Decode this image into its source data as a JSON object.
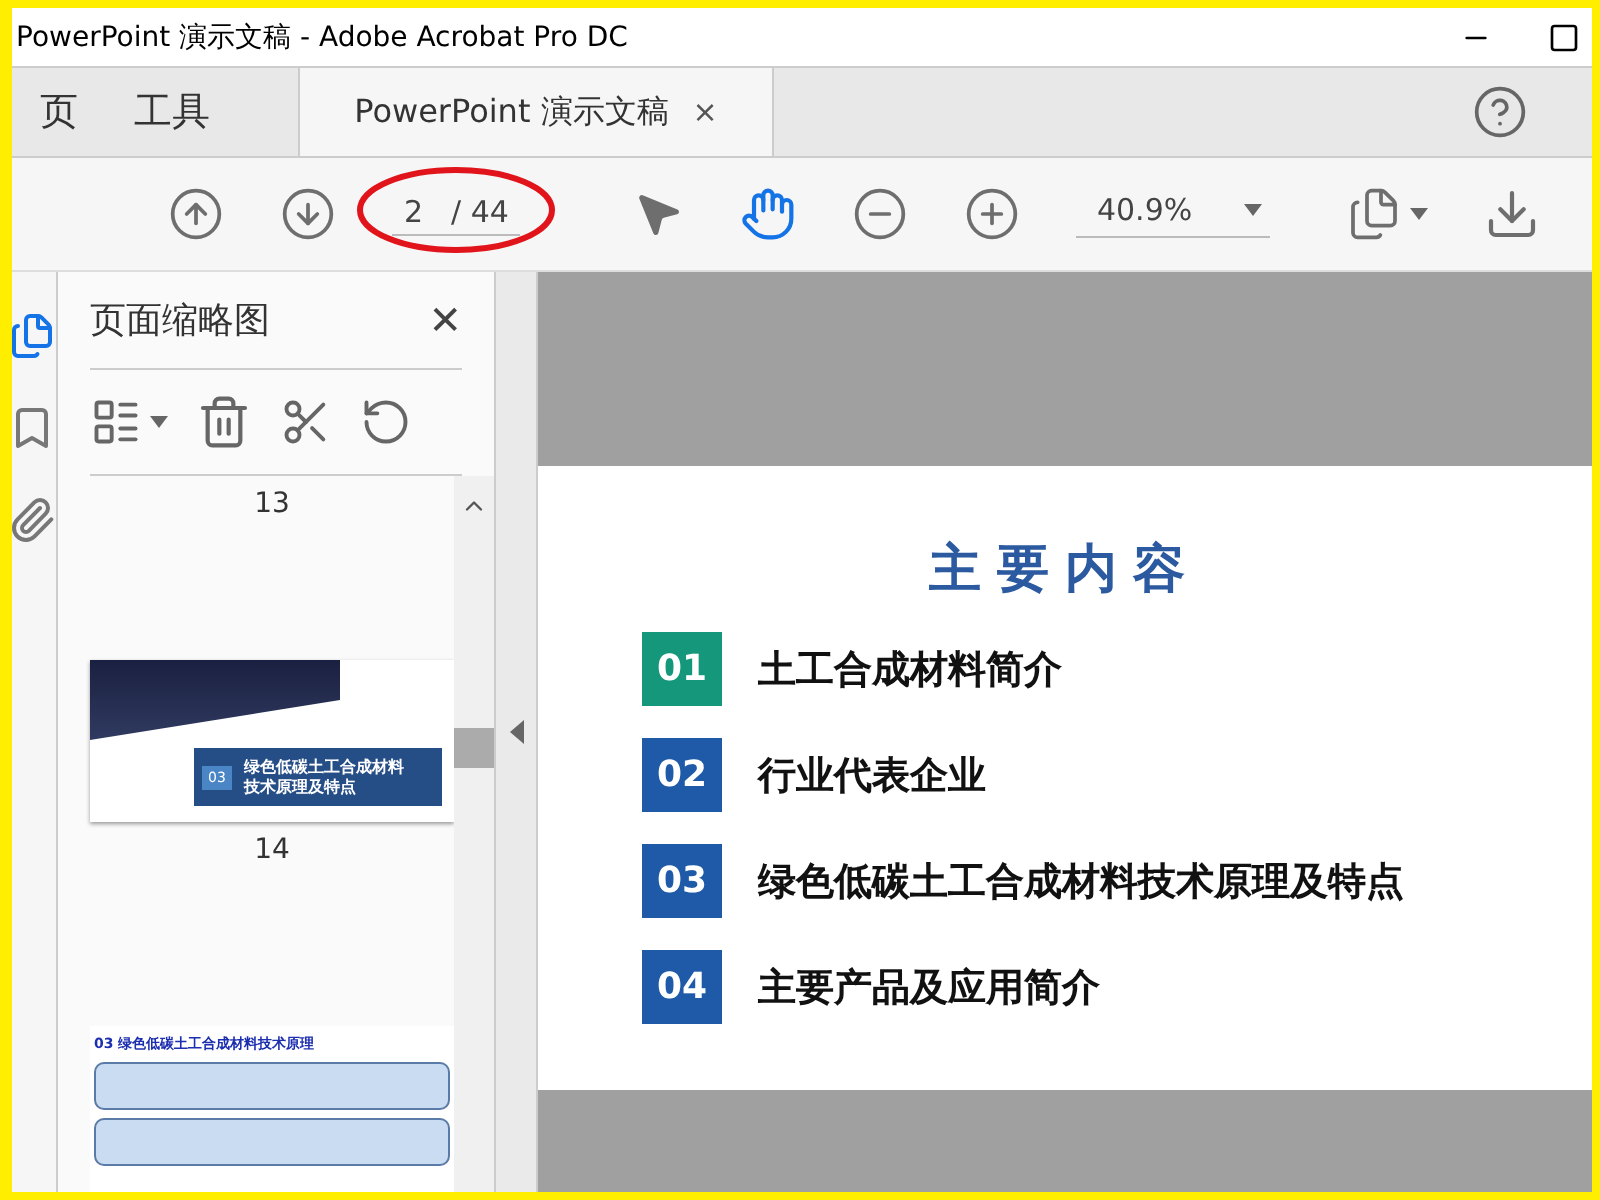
{
  "window": {
    "title": "PowerPoint 演示文稿 - Adobe Acrobat Pro DC"
  },
  "tabs": [
    {
      "label": "页",
      "selected": false,
      "closable": false
    },
    {
      "label": "工具",
      "selected": false,
      "closable": false
    },
    {
      "label": "PowerPoint 演示文稿",
      "selected": true,
      "closable": true,
      "close_label": "×"
    }
  ],
  "toolbar": {
    "page_current": "2",
    "page_total": "/ 44",
    "zoom": "40.9%",
    "hand_selected": true
  },
  "sidebar": {
    "title": "页面缩略图",
    "close_label": "✕",
    "thumbnails": [
      {
        "kind": "label",
        "label": "13"
      },
      {
        "kind": "section",
        "badge": "03",
        "text": "绿色低碳土工合成材料技术原理及特点",
        "label": "14"
      },
      {
        "kind": "content",
        "heading": "03 绿色低碳土工合成材料技术原理"
      }
    ]
  },
  "slide": {
    "title": "主要内容",
    "items": [
      {
        "number": "01",
        "text": "土工合成材料简介",
        "color": "#14977a"
      },
      {
        "number": "02",
        "text": "行业代表企业",
        "color": "#1f5aa8"
      },
      {
        "number": "03",
        "text": "绿色低碳土工合成材料技术原理及特点",
        "color": "#1f5aa8"
      },
      {
        "number": "04",
        "text": "主要产品及应用简介",
        "color": "#1f5aa8"
      }
    ]
  }
}
